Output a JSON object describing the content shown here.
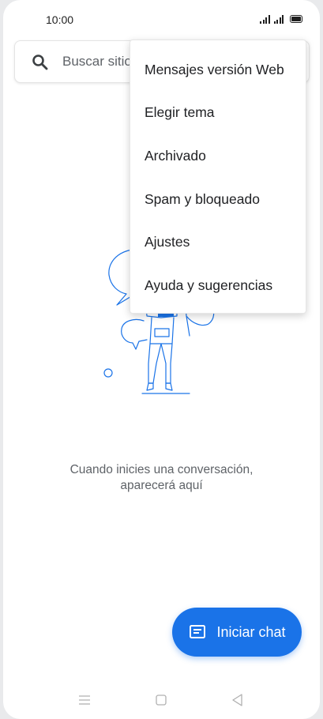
{
  "status_bar": {
    "time": "10:00"
  },
  "search": {
    "placeholder": "Buscar sitio"
  },
  "menu": {
    "items": [
      {
        "label": "Mensajes versión Web"
      },
      {
        "label": "Elegir tema"
      },
      {
        "label": "Archivado"
      },
      {
        "label": "Spam y bloqueado"
      },
      {
        "label": "Ajustes"
      },
      {
        "label": "Ayuda y sugerencias"
      }
    ]
  },
  "empty_state": {
    "line1": "Cuando inicies una conversación,",
    "line2": "aparecerá aquí"
  },
  "fab": {
    "label": "Iniciar chat",
    "icon": "message-icon"
  },
  "nav": {
    "icons": [
      "menu-icon",
      "home-square-icon",
      "back-triangle-icon"
    ]
  },
  "colors": {
    "accent": "#1a73e8",
    "text_primary": "#202124",
    "text_secondary": "#5f6368"
  }
}
